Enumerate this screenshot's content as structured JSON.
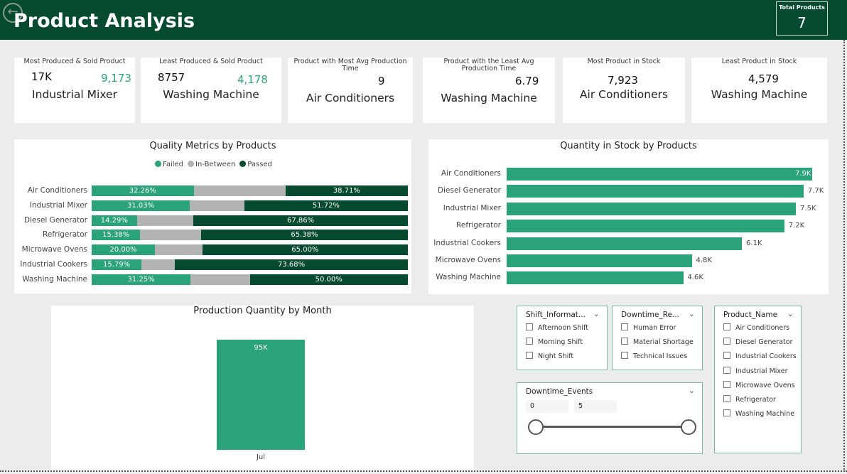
{
  "header": {
    "title": "Product Analysis",
    "total_label": "Total Products",
    "total_value": "7"
  },
  "cards": [
    {
      "label": "Most Produced & Sold Product",
      "value1": "17K",
      "value2": "9,173",
      "name": "Industrial Mixer"
    },
    {
      "label": "Least Produced & Sold Product",
      "value1": "8757",
      "value2": "4,178",
      "name": "Washing Machine"
    },
    {
      "label": "Product with Most Avg Production Time",
      "value1": "9",
      "name": "Air Conditioners"
    },
    {
      "label": "Product with the Least Avg Production Time",
      "value1": "6.79",
      "name": "Washing Machine"
    },
    {
      "label": "Most Product in Stock",
      "value1": "7,923",
      "name": "Air Conditioners"
    },
    {
      "label": "Least Product in Stock",
      "value1": "4,579",
      "name": "Washing Machine"
    }
  ],
  "quality_chart": {
    "title": "Quality Metrics by Products",
    "legend": [
      "Failed",
      "In-Between",
      "Passed"
    ],
    "colors": {
      "Failed": "#2aa37a",
      "In-Between": "#b3b3b3",
      "Passed": "#064a2f"
    }
  },
  "stock_chart": {
    "title": "Quantity in Stock by Products"
  },
  "month_chart": {
    "title": "Production Quantity by Month"
  },
  "chart_data": [
    {
      "type": "bar",
      "orientation": "horizontal",
      "stacked": "100%",
      "title": "Quality Metrics by Products",
      "categories": [
        "Air Conditioners",
        "Industrial Mixer",
        "Diesel Generator",
        "Refrigerator",
        "Microwave Ovens",
        "Industrial Cookers",
        "Washing Machine"
      ],
      "series": [
        {
          "name": "Failed",
          "values": [
            32.26,
            31.03,
            14.29,
            15.38,
            20.0,
            15.79,
            31.25
          ],
          "labels": [
            "32.26%",
            "31.03%",
            "14.29%",
            "15.38%",
            "20.00%",
            "15.79%",
            "31.25%"
          ]
        },
        {
          "name": "In-Between",
          "values": [
            29.03,
            17.24,
            17.86,
            19.23,
            15.0,
            10.53,
            18.75
          ],
          "labels": [
            "",
            "",
            "",
            "",
            "",
            "",
            ""
          ]
        },
        {
          "name": "Passed",
          "values": [
            38.71,
            51.72,
            67.86,
            65.38,
            65.0,
            73.68,
            50.0
          ],
          "labels": [
            "38.71%",
            "51.72%",
            "67.86%",
            "65.38%",
            "65.00%",
            "73.68%",
            "50.00%"
          ]
        }
      ],
      "legend": "top"
    },
    {
      "type": "bar",
      "orientation": "horizontal",
      "title": "Quantity in Stock by Products",
      "categories": [
        "Air Conditioners",
        "Diesel Generator",
        "Industrial Mixer",
        "Refrigerator",
        "Industrial Cookers",
        "Microwave Ovens",
        "Washing Machine"
      ],
      "values": [
        7923,
        7700,
        7500,
        7200,
        6100,
        4800,
        4579
      ],
      "labels": [
        "7.9K",
        "7.7K",
        "7.5K",
        "7.2K",
        "6.1K",
        "4.8K",
        "4.6K"
      ]
    },
    {
      "type": "bar",
      "title": "Production Quantity by Month",
      "categories": [
        "Jul"
      ],
      "values": [
        95000
      ],
      "labels": [
        "95K"
      ]
    }
  ],
  "slicers": {
    "shift": {
      "title": "Shift_Informat...",
      "options": [
        "Afternoon Shift",
        "Morning Shift",
        "Night Shift"
      ]
    },
    "downtime_reason": {
      "title": "Downtime_Re...",
      "options": [
        "Human Error",
        "Material Shortage",
        "Technical Issues"
      ]
    },
    "product": {
      "title": "Product_Name",
      "options": [
        "Air Conditioners",
        "Diesel Generator",
        "Industrial Cookers",
        "Industrial Mixer",
        "Microwave Ovens",
        "Refrigerator",
        "Washing Machine"
      ]
    },
    "downtime_events": {
      "title": "Downtime_Events",
      "min": "0",
      "max": "5"
    }
  }
}
